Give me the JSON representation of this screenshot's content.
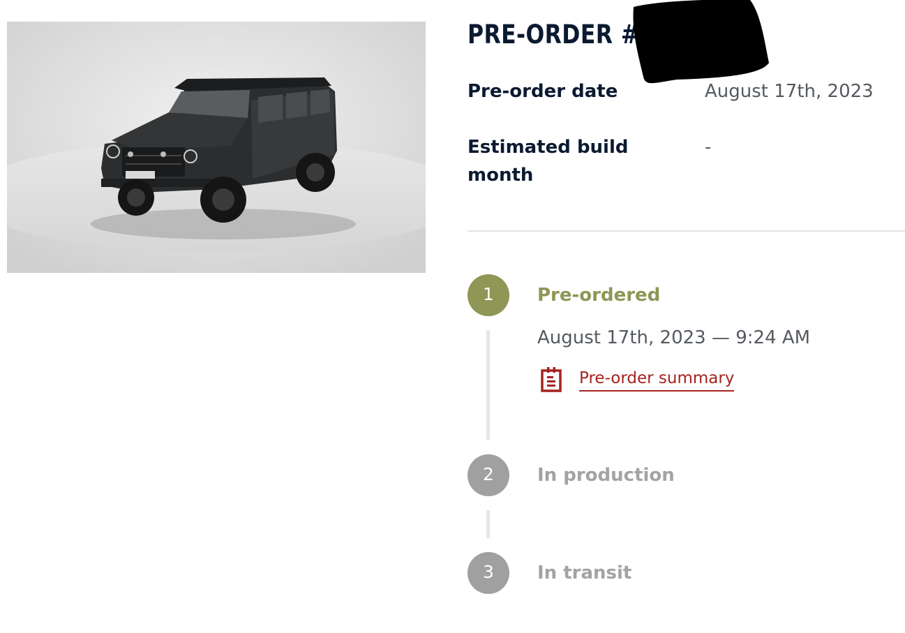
{
  "order": {
    "title": "PRE-ORDER #00",
    "details": [
      {
        "label": "Pre-order date",
        "value": "August 17th, 2023"
      },
      {
        "label": "Estimated build month",
        "value": "-"
      }
    ]
  },
  "timeline": {
    "steps": [
      {
        "number": "1",
        "label": "Pre-ordered",
        "state": "active",
        "date": "August 17th, 2023 — 9:24 AM",
        "link": "Pre-order summary"
      },
      {
        "number": "2",
        "label": "In production",
        "state": "inactive"
      },
      {
        "number": "3",
        "label": "In transit",
        "state": "inactive"
      }
    ]
  },
  "colors": {
    "accent_active": "#8f9656",
    "inactive": "#a0a0a0",
    "link": "#a5231f",
    "heading": "#0b1a30"
  },
  "icons": {
    "summary_link_icon": "clipboard-icon"
  }
}
